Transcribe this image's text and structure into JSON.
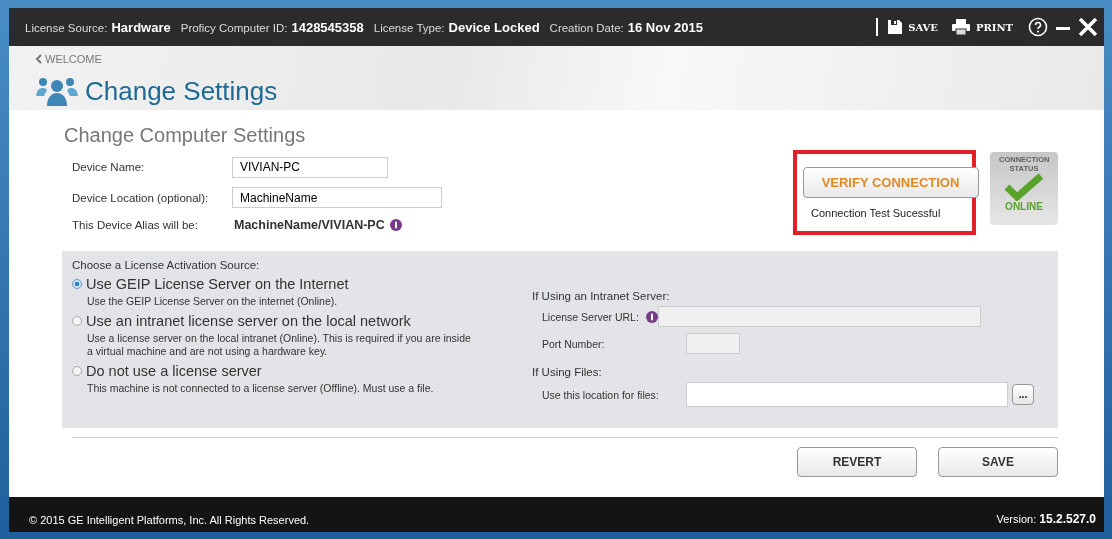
{
  "top_bar": {
    "info": [
      {
        "label": "License Source:",
        "value": "Hardware"
      },
      {
        "label": "Proficy Computer ID:",
        "value": "1428545358"
      },
      {
        "label": "License Type:",
        "value": "Device Locked"
      },
      {
        "label": "Creation Date:",
        "value": "16 Nov 2015"
      }
    ],
    "save_label": "SAVE",
    "print_label": "PRINT"
  },
  "header": {
    "back_link": "WELCOME",
    "title": "Change Settings"
  },
  "section_title": "Change Computer Settings",
  "device": {
    "name_label": "Device Name:",
    "name_value": "VIVIAN-PC",
    "location_label": "Device Location (optional):",
    "location_value": "MachineName",
    "alias_label": "This Device Alias will be:",
    "alias_value": "MachineName/VIVIAN-PC"
  },
  "connection": {
    "verify_button": "VERIFY CONNECTION",
    "result": "Connection Test Sucessful",
    "status_heading": "CONNECTION STATUS",
    "status": "ONLINE",
    "online": true
  },
  "activation": {
    "heading": "Choose a License Activation Source:",
    "options": [
      {
        "label": "Use GEIP License Server on the Internet",
        "description": "Use the GEIP License Server on the internet (Online).",
        "selected": true
      },
      {
        "label": "Use an intranet license server on the local network",
        "description": "Use a license server on the local intranet (Online). This is required if you are inside a virtual machine and are not using a hardware key.",
        "selected": false
      },
      {
        "label": "Do not use a license server",
        "description": "This machine is not connected to a license server (Offline). Must use a file.",
        "selected": false
      }
    ]
  },
  "intranet": {
    "heading": "If Using an Intranet Server:",
    "url_label": "License Server URL:",
    "port_label": "Port Number:",
    "disabled": true
  },
  "files": {
    "heading": "If Using Files:",
    "location_label": "Use this location for files:",
    "browse_button": "..."
  },
  "buttons": [
    "REVERT",
    "SAVE"
  ],
  "footer": {
    "copyright": "© 2015 GE Intelligent Platforms, Inc.  All Rights Reserved.",
    "version_label": "Version:",
    "version": "15.2.527.0"
  }
}
